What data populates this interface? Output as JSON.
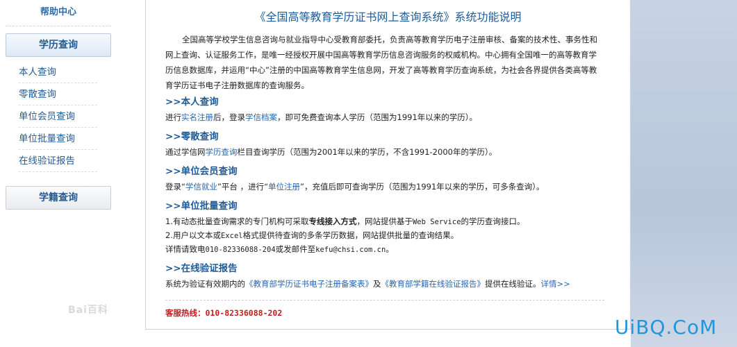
{
  "sidebar": {
    "help_title": "帮助中心",
    "btn_xueli": "学历查询",
    "links": [
      "本人查询",
      "零散查询",
      "单位会员查询",
      "单位批量查询",
      "在线验证报告"
    ],
    "btn_xueji": "学籍查询",
    "watermark": "Bai百科"
  },
  "main": {
    "title": "《全国高等教育学历证书网上查询系统》系统功能说明",
    "intro": "全国高等学校学生信息咨询与就业指导中心受教育部委托，负责高等教育学历电子注册审核、备案的技术性、事务性和网上查询、认证服务工作，是唯一经授权开展中国高等教育学历信息咨询服务的权威机构。中心拥有全国唯一的高等教育学历信息数据库，并运用“中心”注册的中国高等教育学生信息网，开发了高等教育学历查询系统，为社会各界提供各类高等教育学历证书电子注册数据库的查询服务。",
    "s1": {
      "heading": ">>本人查询",
      "a": "进行",
      "link1": "实名注册",
      "b": "后，登录",
      "link2": "学信档案",
      "c": "，即可免费查询本人学历（范围为1991年以来的学历）。"
    },
    "s2": {
      "heading": ">>零散查询",
      "a": "通过学信网",
      "link1": "学历查询",
      "b": "栏目查询学历（范围为2001年以来的学历，不含1991-2000年的学历）。"
    },
    "s3": {
      "heading": ">>单位会员查询",
      "a": "登录“",
      "link1": "学信就业",
      "b": "”平台 ，进行“",
      "link2": "单位注册",
      "c": "”，充值后即可查询学历（范围为1991年以来的学历，可多条查询）。"
    },
    "s4": {
      "heading": ">>单位批量查询",
      "l1a": "1.有动态批量查询需求的专门机构可采取",
      "l1b": "专线接入方式",
      "l1c": "，网站提供基于",
      "l1d": "Web Service",
      "l1e": "的学历查询接口。",
      "l2a": "2.用户以文本或",
      "l2b": "Excel",
      "l2c": "格式提供待查询的多条学历数据，网站提供批量的查询结果。",
      "l3a": "详情请致电",
      "l3b": "010-82336088-204",
      "l3c": "或发邮件至",
      "l3d": "kefu@chsi.com.cn",
      "l3e": "。"
    },
    "s5": {
      "heading": ">>在线验证报告",
      "a": "系统为验证有效期内的",
      "link1": "《教育部学历证书电子注册备案表》",
      "b": "及",
      "link2": "《教育部学籍在线验证报告》",
      "c": "提供在线验证。",
      "link3": "详情>>"
    },
    "hotline_label": "客服热线：",
    "hotline_number": "010-82336088-202"
  },
  "watermark_uibq": "UiBQ.CoM"
}
